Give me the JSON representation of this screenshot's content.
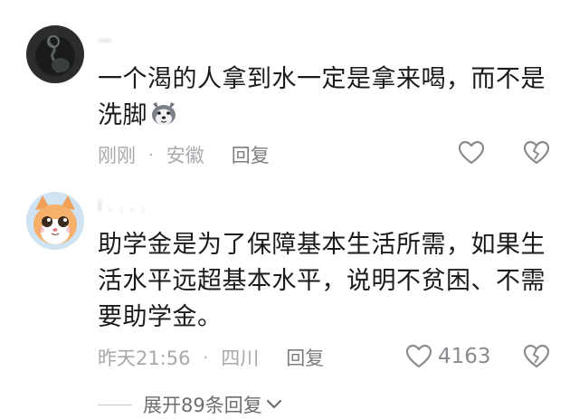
{
  "comments": [
    {
      "username": "一",
      "text_line1": "一个渴的人拿到水一定是拿来喝，而不是",
      "text_line2": "洗脚",
      "emoji": "husky-emoji",
      "time": "刚刚",
      "location": "安徽",
      "reply_label": "回复",
      "like_count": ""
    },
    {
      "username": "l . . . .",
      "text_line1": "助学金是为了保障基本生活所需，如果生",
      "text_line2": "活水平远超基本水平，说明不贫困、不需",
      "text_line3": "要助学金。",
      "time": "昨天21:56",
      "location": "四川",
      "reply_label": "回复",
      "like_count": "4163"
    }
  ],
  "expand_label": "展开89条回复",
  "icons": {
    "like": "heart-icon",
    "dislike": "broken-heart-icon",
    "expand": "chevron-down-icon"
  },
  "colors": {
    "meta": "#a8a8ad",
    "icon": "#8a8a90",
    "text": "#1a1a1a"
  }
}
